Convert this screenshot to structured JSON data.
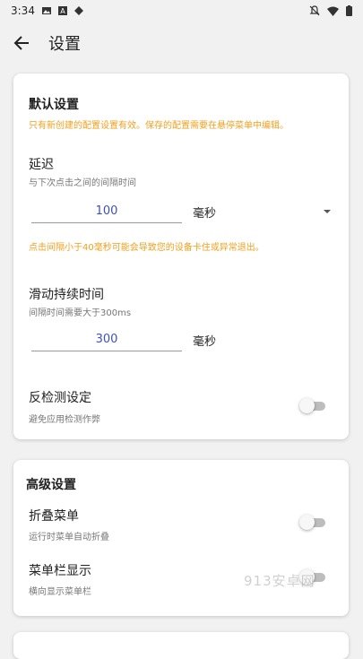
{
  "status_bar": {
    "time": "3:34",
    "icons": [
      "image-icon",
      "a-icon",
      "diamond-icon",
      "bell-off-icon",
      "wifi-icon",
      "battery-icon"
    ]
  },
  "app_bar": {
    "title": "设置"
  },
  "default_settings": {
    "title": "默认设置",
    "note": "只有新创建的配置设置有效。保存的配置需要在悬停菜单中编辑。",
    "delay": {
      "label": "延迟",
      "sublabel": "与下次点击之间的间隔时间",
      "value": "100",
      "unit": "毫秒",
      "warning": "点击间隔小于40毫秒可能会导致您的设备卡住或异常退出。"
    },
    "swipe": {
      "label": "滑动持续时间",
      "sublabel": "间隔时间需要大于300ms",
      "value": "300",
      "unit": "毫秒"
    },
    "anti_detect": {
      "label": "反检测设定",
      "sublabel": "避免应用检测作弊",
      "enabled": false
    }
  },
  "advanced_settings": {
    "title": "高级设置",
    "fold_menu": {
      "label": "折叠菜单",
      "sublabel": "运行时菜单自动折叠",
      "enabled": false
    },
    "menu_bar": {
      "label": "菜单栏显示",
      "sublabel": "横向显示菜单栏",
      "enabled": false
    }
  },
  "watermark": "913安卓网",
  "colors": {
    "accent": "#3f51b5",
    "warning": "#f0a020",
    "background": "#f1f1f1"
  }
}
